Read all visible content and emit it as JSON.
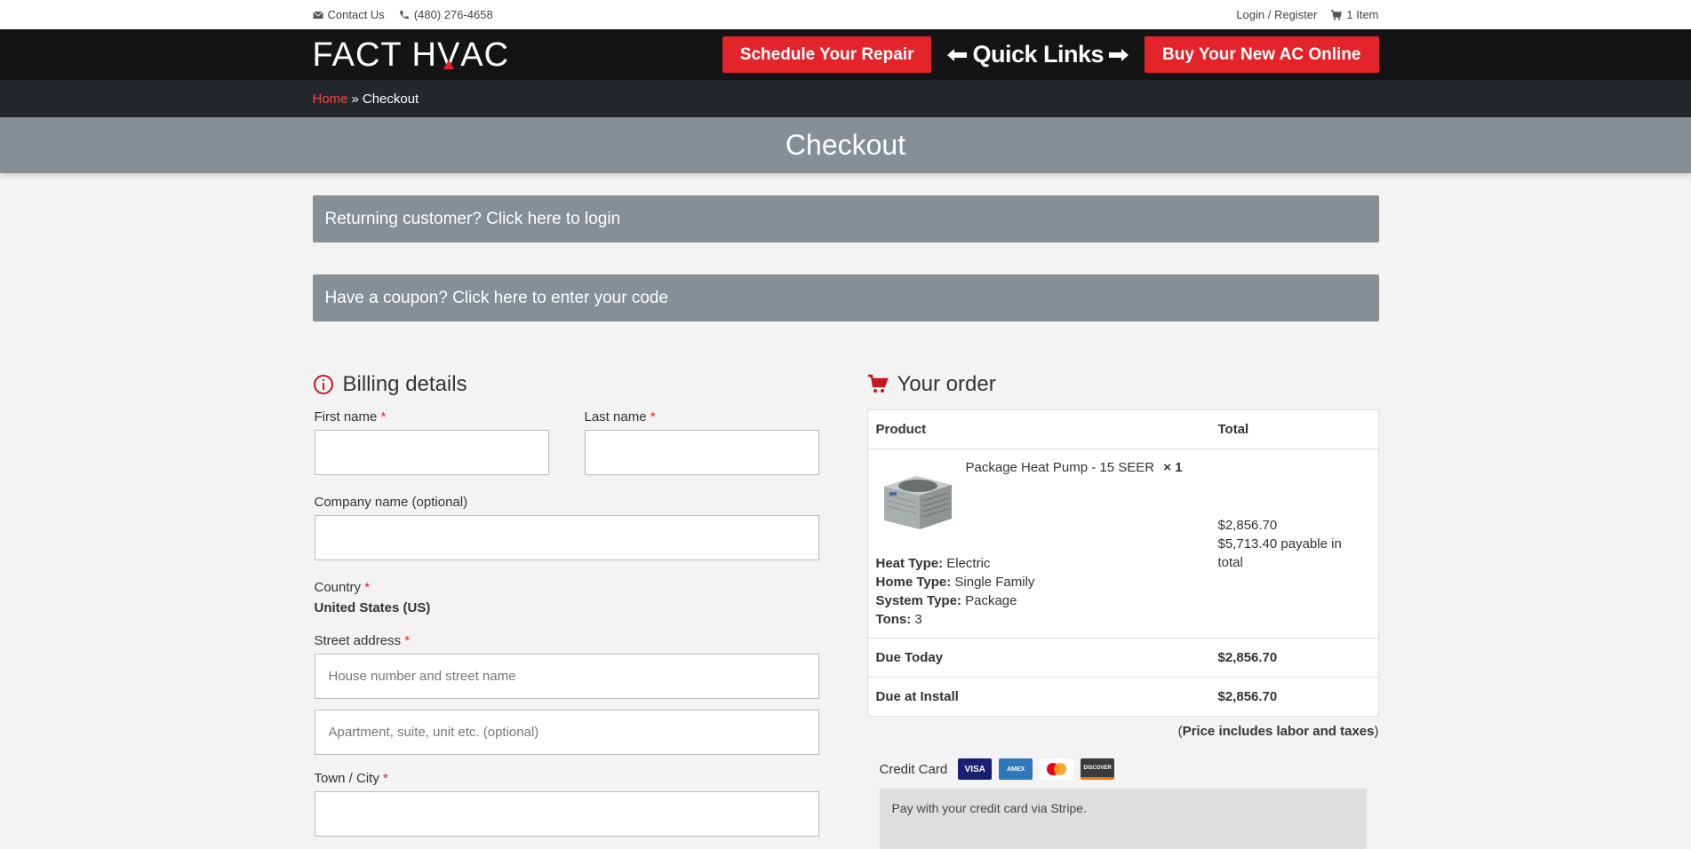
{
  "topbar": {
    "contact": "Contact Us",
    "phone": "(480) 276-4658",
    "login": "Login / Register",
    "cart": "1 Item"
  },
  "header": {
    "logo_text_a": "FACT H",
    "logo_text_v": "V",
    "logo_text_b": "AC",
    "schedule_button": "Schedule Your Repair",
    "quick_links": "Quick Links",
    "buy_button": "Buy Your New AC Online"
  },
  "breadcrumb": {
    "home": "Home",
    "sep": "»",
    "current": "Checkout"
  },
  "page_title": "Checkout",
  "notices": {
    "returning": "Returning customer? Click here to login",
    "coupon": "Have a coupon? Click here to enter your code"
  },
  "billing": {
    "heading": "Billing details",
    "first_name_label": "First name",
    "last_name_label": "Last name",
    "company_label": "Company name (optional)",
    "country_label": "Country",
    "country_value": "United States (US)",
    "street_label": "Street address",
    "street_placeholder": "House number and street name",
    "apt_placeholder": "Apartment, suite, unit etc. (optional)",
    "city_label": "Town / City",
    "required_mark": "*"
  },
  "order": {
    "heading": "Your order",
    "col_product": "Product",
    "col_total": "Total",
    "product_name": "Package Heat Pump - 15 SEER",
    "product_qty": "× 1",
    "attributes": [
      {
        "key": "Heat Type:",
        "value": "Electric"
      },
      {
        "key": "Home Type:",
        "value": "Single Family"
      },
      {
        "key": "System Type:",
        "value": "Package"
      },
      {
        "key": "Tons:",
        "value": "3"
      }
    ],
    "line_price": "$2,856.70",
    "line_total_note": "$5,713.40 payable in total",
    "due_today_label": "Due Today",
    "due_today_value": "$2,856.70",
    "due_install_label": "Due at Install",
    "due_install_value": "$2,856.70",
    "price_note_open": "(",
    "price_note": "Price includes labor and taxes",
    "price_note_close": ")"
  },
  "payment": {
    "method_label": "Credit Card",
    "cards": [
      "VISA",
      "AMEX",
      "MC",
      "DISCOVER"
    ],
    "description": "Pay with your credit card via Stripe."
  },
  "colors": {
    "accent_red": "#e3242b",
    "header_black": "#141414",
    "breadcrumb_bg": "#22282c",
    "title_bg": "#858f95"
  }
}
